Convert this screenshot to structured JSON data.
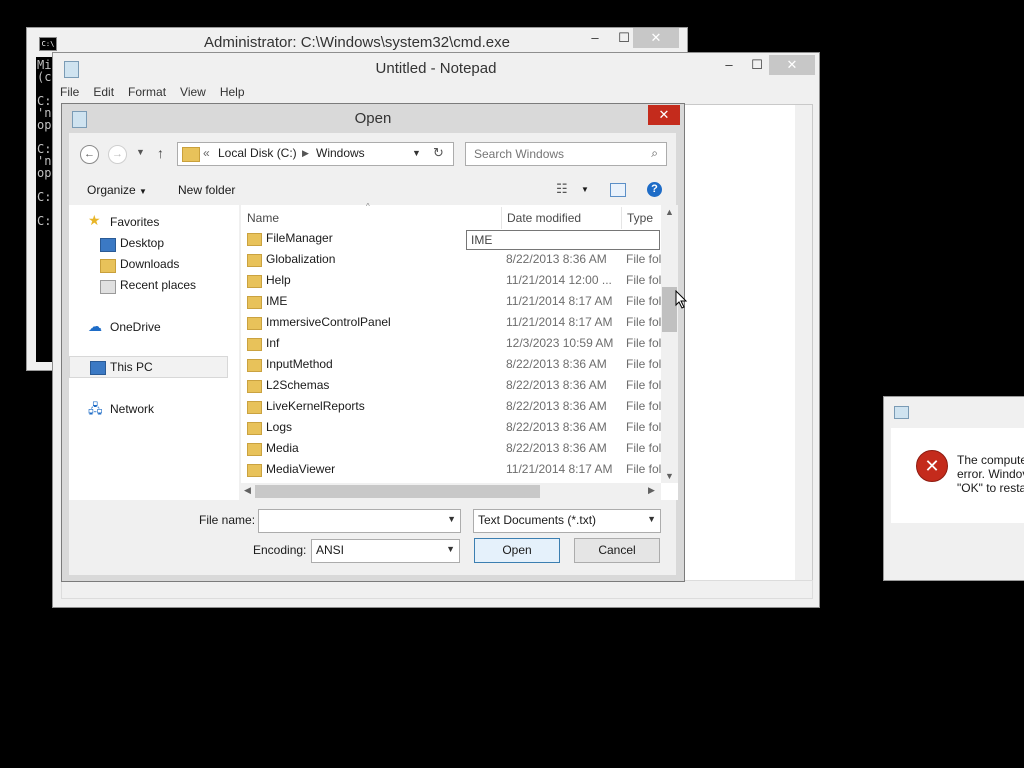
{
  "cmd": {
    "title": "Administrator: C:\\Windows\\system32\\cmd.exe",
    "icon_text": "C:\\",
    "console_lines": [
      "Mi",
      "(c",
      "",
      "C:",
      "'n",
      "op",
      "",
      "C:",
      "'n",
      "op",
      "",
      "C:",
      "",
      "C:"
    ],
    "minimize": "–",
    "maximize": "☐",
    "close": "✕"
  },
  "notepad": {
    "title": "Untitled - Notepad",
    "menu": [
      "File",
      "Edit",
      "Format",
      "View",
      "Help"
    ],
    "minimize": "–",
    "maximize": "☐",
    "close": "✕"
  },
  "open_dialog": {
    "title": "Open",
    "close": "✕",
    "address": {
      "sep": "«",
      "parts": [
        "Local Disk (C:)",
        "Windows"
      ]
    },
    "search_placeholder": "Search Windows",
    "toolbar": {
      "organize": "Organize",
      "new_folder": "New folder",
      "help": "?"
    },
    "nav": {
      "favorites": "Favorites",
      "desktop": "Desktop",
      "downloads": "Downloads",
      "recent": "Recent places",
      "onedrive": "OneDrive",
      "this_pc": "This PC",
      "network": "Network"
    },
    "columns": {
      "name": "Name",
      "date": "Date modified",
      "type": "Type"
    },
    "rows": [
      {
        "name": "FileManager",
        "date": "",
        "type": ""
      },
      {
        "name": "Globalization",
        "date": "8/22/2013 8:36 AM",
        "type": "File fol"
      },
      {
        "name": "Help",
        "date": "11/21/2014 12:00 ...",
        "type": "File fol"
      },
      {
        "name": "IME",
        "date": "11/21/2014 8:17 AM",
        "type": "File fol"
      },
      {
        "name": "ImmersiveControlPanel",
        "date": "11/21/2014 8:17 AM",
        "type": "File fol"
      },
      {
        "name": "Inf",
        "date": "12/3/2023 10:59 AM",
        "type": "File fol"
      },
      {
        "name": "InputMethod",
        "date": "8/22/2013 8:36 AM",
        "type": "File fol"
      },
      {
        "name": "L2Schemas",
        "date": "8/22/2013 8:36 AM",
        "type": "File fol"
      },
      {
        "name": "LiveKernelReports",
        "date": "8/22/2013 8:36 AM",
        "type": "File fol"
      },
      {
        "name": "Logs",
        "date": "8/22/2013 8:36 AM",
        "type": "File fol"
      },
      {
        "name": "Media",
        "date": "8/22/2013 8:36 AM",
        "type": "File fol"
      },
      {
        "name": "MediaViewer",
        "date": "11/21/2014 8:17 AM",
        "type": "File fol"
      }
    ],
    "tooltip": "IME",
    "file_name_label": "File name:",
    "file_name_value": "",
    "file_type": "Text Documents (*.txt)",
    "encoding_label": "Encoding:",
    "encoding_value": "ANSI",
    "open_button": "Open",
    "cancel_button": "Cancel"
  },
  "error_dialog": {
    "icon": "✕",
    "lines": [
      "The compute",
      "error. Windov",
      "\"OK\" to resta"
    ]
  },
  "colors": {
    "close_red": "#c42b1c",
    "folder_yellow": "#e8c25a",
    "link_blue": "#1e6cc7"
  }
}
